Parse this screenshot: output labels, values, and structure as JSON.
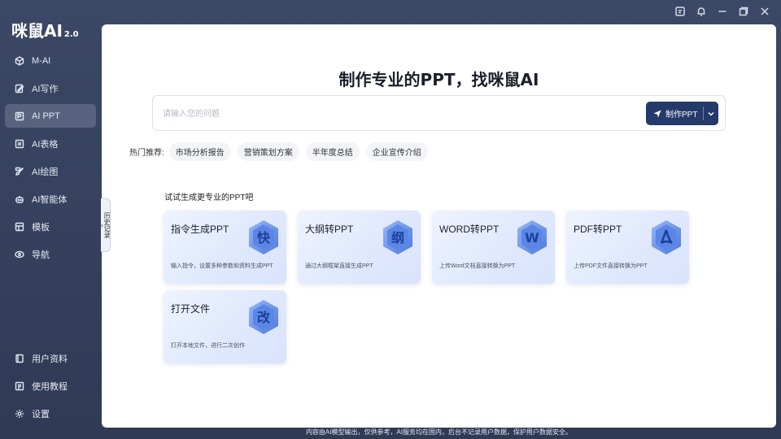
{
  "app": {
    "logo": "咪鼠AI",
    "version": "2.0"
  },
  "sidebar": {
    "items": [
      {
        "label": "M-AI",
        "icon": "cube-icon"
      },
      {
        "label": "AI写作",
        "icon": "edit-icon"
      },
      {
        "label": "AI PPT",
        "icon": "ppt-icon",
        "active": true
      },
      {
        "label": "AI表格",
        "icon": "table-icon"
      },
      {
        "label": "AI绘图",
        "icon": "paint-icon"
      },
      {
        "label": "AI智能体",
        "icon": "robot-icon"
      },
      {
        "label": "模板",
        "icon": "template-icon"
      },
      {
        "label": "导航",
        "icon": "navigation-icon"
      }
    ],
    "bottom_items": [
      {
        "label": "用户资料",
        "icon": "user-doc-icon"
      },
      {
        "label": "使用教程",
        "icon": "tutorial-icon"
      },
      {
        "label": "设置",
        "icon": "settings-icon"
      }
    ]
  },
  "history_tab": {
    "label": "历史记录"
  },
  "main": {
    "headline": "制作专业的PPT，找咪鼠AI",
    "search": {
      "placeholder": "请输入您的问题",
      "value": ""
    },
    "make_button": {
      "label": "制作PPT"
    },
    "hot": {
      "label": "热门推荐:",
      "chips": [
        "市场分析报告",
        "营销策划方案",
        "半年度总结",
        "企业宣传介绍"
      ]
    },
    "try_label": "试试生成更专业的PPT吧",
    "cards": [
      {
        "title": "指令生成PPT",
        "desc": "输入指令，设置多种参数和资料生成PPT",
        "glyph": "快"
      },
      {
        "title": "大纲转PPT",
        "desc": "通过大纲框架直接生成PPT",
        "glyph": "纲"
      },
      {
        "title": "WORD转PPT",
        "desc": "上传Word文档直接转换为PPT",
        "glyph": "W"
      },
      {
        "title": "PDF转PPT",
        "desc": "上传PDF文件直接转换为PPT",
        "glyph": ""
      },
      {
        "title": "打开文件",
        "desc": "打开本地文件，进行二次创作",
        "glyph": "改"
      }
    ]
  },
  "footer": "内容由AI模型输出，仅供参考，AI服务均在国内，后台不记录用户数据，保护用户数据安全。",
  "colors": {
    "accent": "#243a6b",
    "sidebar_active": "#58637f",
    "background": "#3b4866"
  }
}
